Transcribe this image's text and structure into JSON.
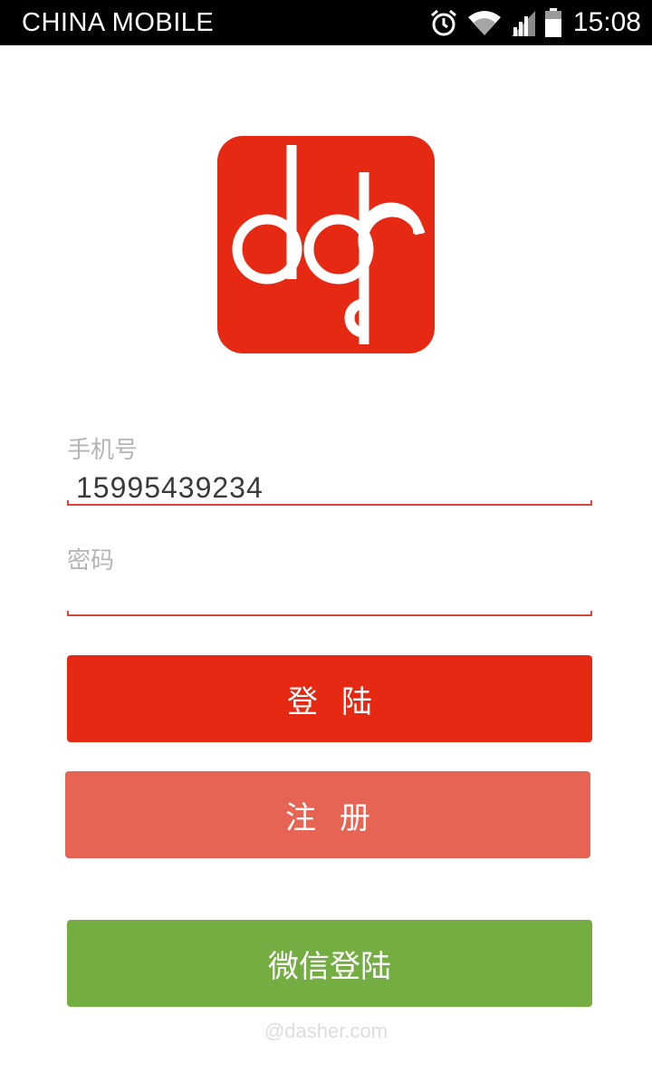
{
  "status_bar": {
    "carrier": "CHINA  MOBILE",
    "time": "15:08",
    "icons": [
      "alarm-icon",
      "wifi-icon",
      "signal-icon",
      "battery-icon"
    ]
  },
  "logo": {
    "icon": "ddr-logo-icon",
    "color": "#e52912"
  },
  "form": {
    "phone": {
      "label": "手机号",
      "value": "15995439234"
    },
    "password": {
      "label": "密码",
      "value": ""
    }
  },
  "buttons": {
    "login": "登陆",
    "register": "注册",
    "wechat_login": "微信登陆"
  },
  "colors": {
    "login": "#e52912",
    "register": "#e56453",
    "wechat": "#74ae43",
    "underline": "#d9473b"
  },
  "watermark": "@dasher.com"
}
